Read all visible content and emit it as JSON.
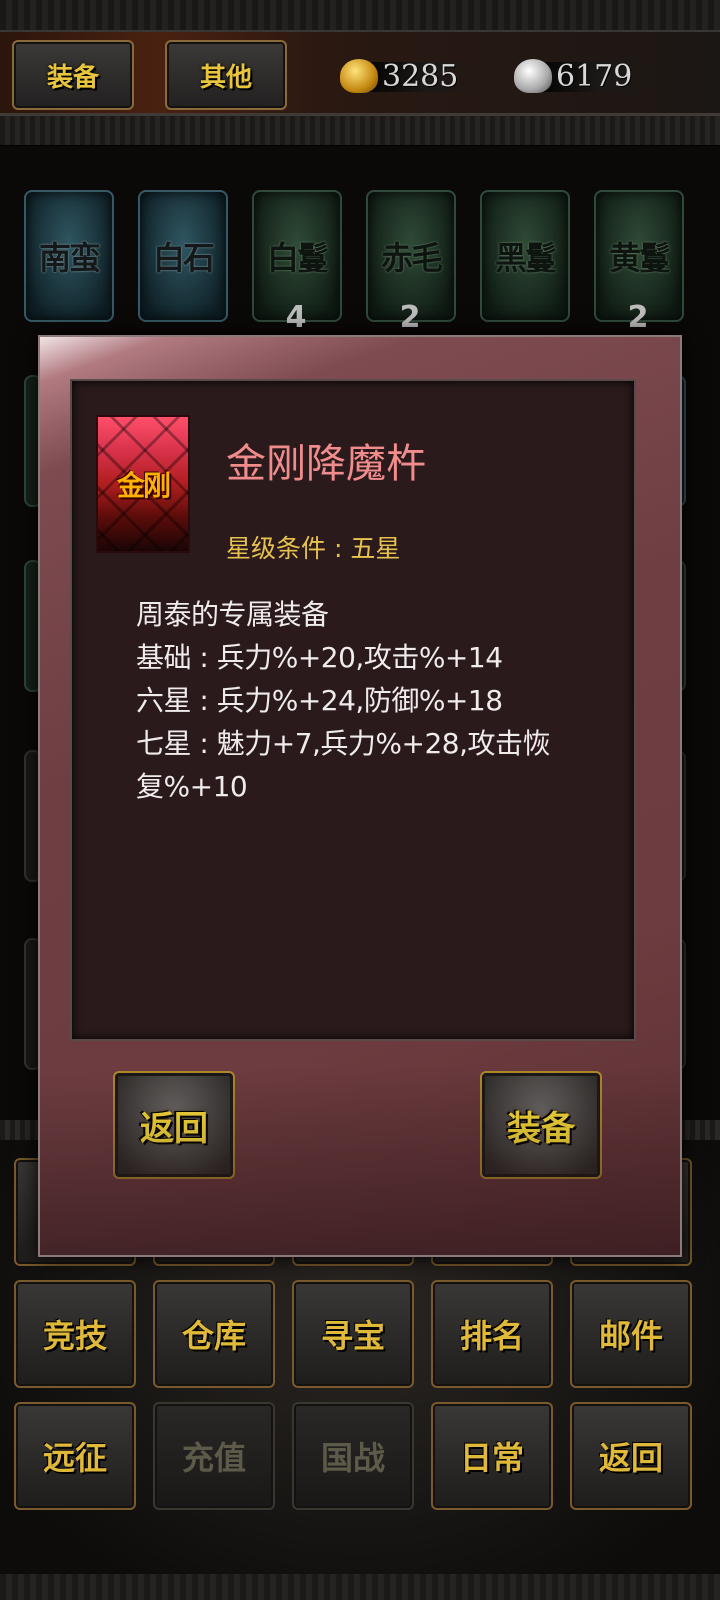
{
  "header": {
    "tabs": [
      {
        "label": "装备"
      },
      {
        "label": "其他"
      }
    ],
    "gold": "3285",
    "silver": "6179"
  },
  "cards": [
    {
      "name": "南蛮",
      "count": ""
    },
    {
      "name": "白石",
      "count": ""
    },
    {
      "name": "白鬘",
      "count": "4"
    },
    {
      "name": "赤毛",
      "count": "2"
    },
    {
      "name": "黑鬘",
      "count": ""
    },
    {
      "name": "黄鬘",
      "count": "2"
    }
  ],
  "menu": {
    "row1": [
      "竞技",
      "仓库",
      "寻宝",
      "排名",
      "邮件"
    ],
    "row2": [
      "远征",
      "充值",
      "国战",
      "日常",
      "返回"
    ]
  },
  "modal": {
    "icon_label": "金刚",
    "item_name": "金刚降魔杵",
    "star_requirement": "星级条件 : 五星",
    "lines": [
      "周泰的专属装备",
      "基础 : 兵力%+20,攻击%+14",
      "六星 : 兵力%+24,防御%+18",
      "七星 : 魅力+7,兵力%+28,攻击恢复%+10"
    ],
    "back_label": "返回",
    "equip_label": "装备"
  }
}
